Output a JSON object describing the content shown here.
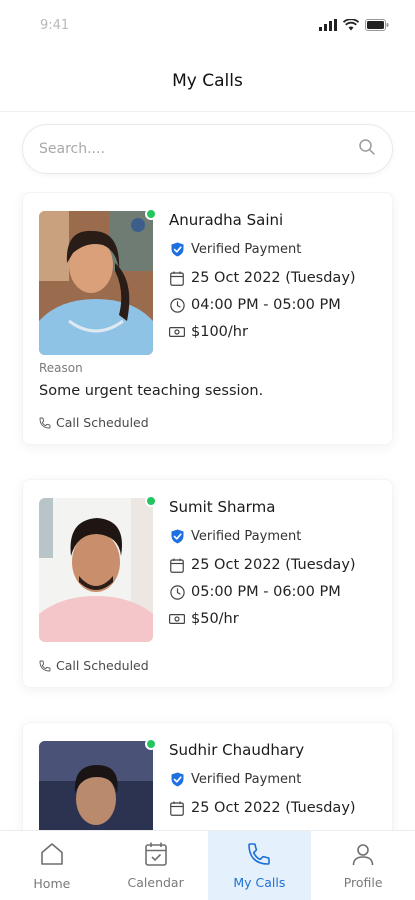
{
  "status_bar": {
    "time": "9:41",
    "icons": [
      "signal-icon",
      "wifi-icon",
      "battery-icon"
    ]
  },
  "header": {
    "title": "My Calls"
  },
  "search": {
    "placeholder": "Search...."
  },
  "calls": [
    {
      "name": "Anuradha Saini",
      "verified_label": "Verified Payment",
      "date": "25 Oct 2022 (Tuesday)",
      "time": "04:00 PM - 05:00 PM",
      "rate": "$100/hr",
      "reason_label": "Reason",
      "reason": "Some urgent teaching session.",
      "status": "Call Scheduled",
      "online": true
    },
    {
      "name": "Sumit Sharma",
      "verified_label": "Verified Payment",
      "date": "25 Oct 2022 (Tuesday)",
      "time": "05:00 PM - 06:00 PM",
      "rate": "$50/hr",
      "status": "Call Scheduled",
      "online": true
    },
    {
      "name": "Sudhir Chaudhary",
      "verified_label": "Verified Payment",
      "date": "25 Oct 2022 (Tuesday)",
      "online": true
    }
  ],
  "tabs": [
    {
      "label": "Home",
      "icon": "home-icon",
      "active": false
    },
    {
      "label": "Calendar",
      "icon": "calendar-icon",
      "active": false
    },
    {
      "label": "My Calls",
      "icon": "phone-icon",
      "active": true
    },
    {
      "label": "Profile",
      "icon": "user-icon",
      "active": false
    }
  ],
  "colors": {
    "accent": "#1f6fd6",
    "active_tab_bg": "#e4f1fc",
    "online": "#22c55e",
    "verified_shield": "#1e6fe0"
  }
}
